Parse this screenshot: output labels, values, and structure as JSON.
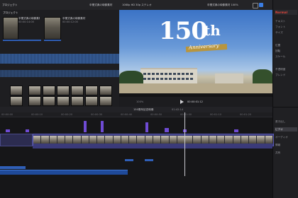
{
  "topbar": {
    "left_label": "プロジェクト",
    "center_left": "卒業式典の映像素材",
    "center_mid": "1080p HD 30p ステレオ",
    "center_right": "卒業式典の映像素材 100%",
    "right_label": "150周年"
  },
  "browser": {
    "title": "プロジェクト",
    "clips": [
      {
        "title": "卒業式典の映像素材",
        "duration": "00:00:14:00"
      },
      {
        "title": "卒業式典の映像素材",
        "duration": "00:00:12:00"
      }
    ],
    "photo_rows": 3,
    "status": "1 / 26 項目選択済み"
  },
  "viewer": {
    "title_number": "150",
    "title_suffix": "th",
    "subtitle": "Anniversary",
    "timecode": "00:00:01:12",
    "zoom": "100%"
  },
  "inspector": {
    "title": "Normal",
    "rows": [
      "テキスト",
      "フォント",
      "サイズ",
      "位置",
      "回転",
      "スケール",
      "不透明度",
      "ブレンド"
    ],
    "bottom_items": [
      "書き出し",
      "ビデオ",
      "オーディオ",
      "情報",
      "共有"
    ]
  },
  "timeline": {
    "project": "150周年記念映像",
    "duration": "01:42:14",
    "ruler_marks": [
      "00:00:00",
      "00:00:10",
      "00:00:20",
      "00:00:30",
      "00:00:40",
      "00:00:50",
      "00:01:00",
      "00:01:10",
      "00:01:20"
    ]
  }
}
